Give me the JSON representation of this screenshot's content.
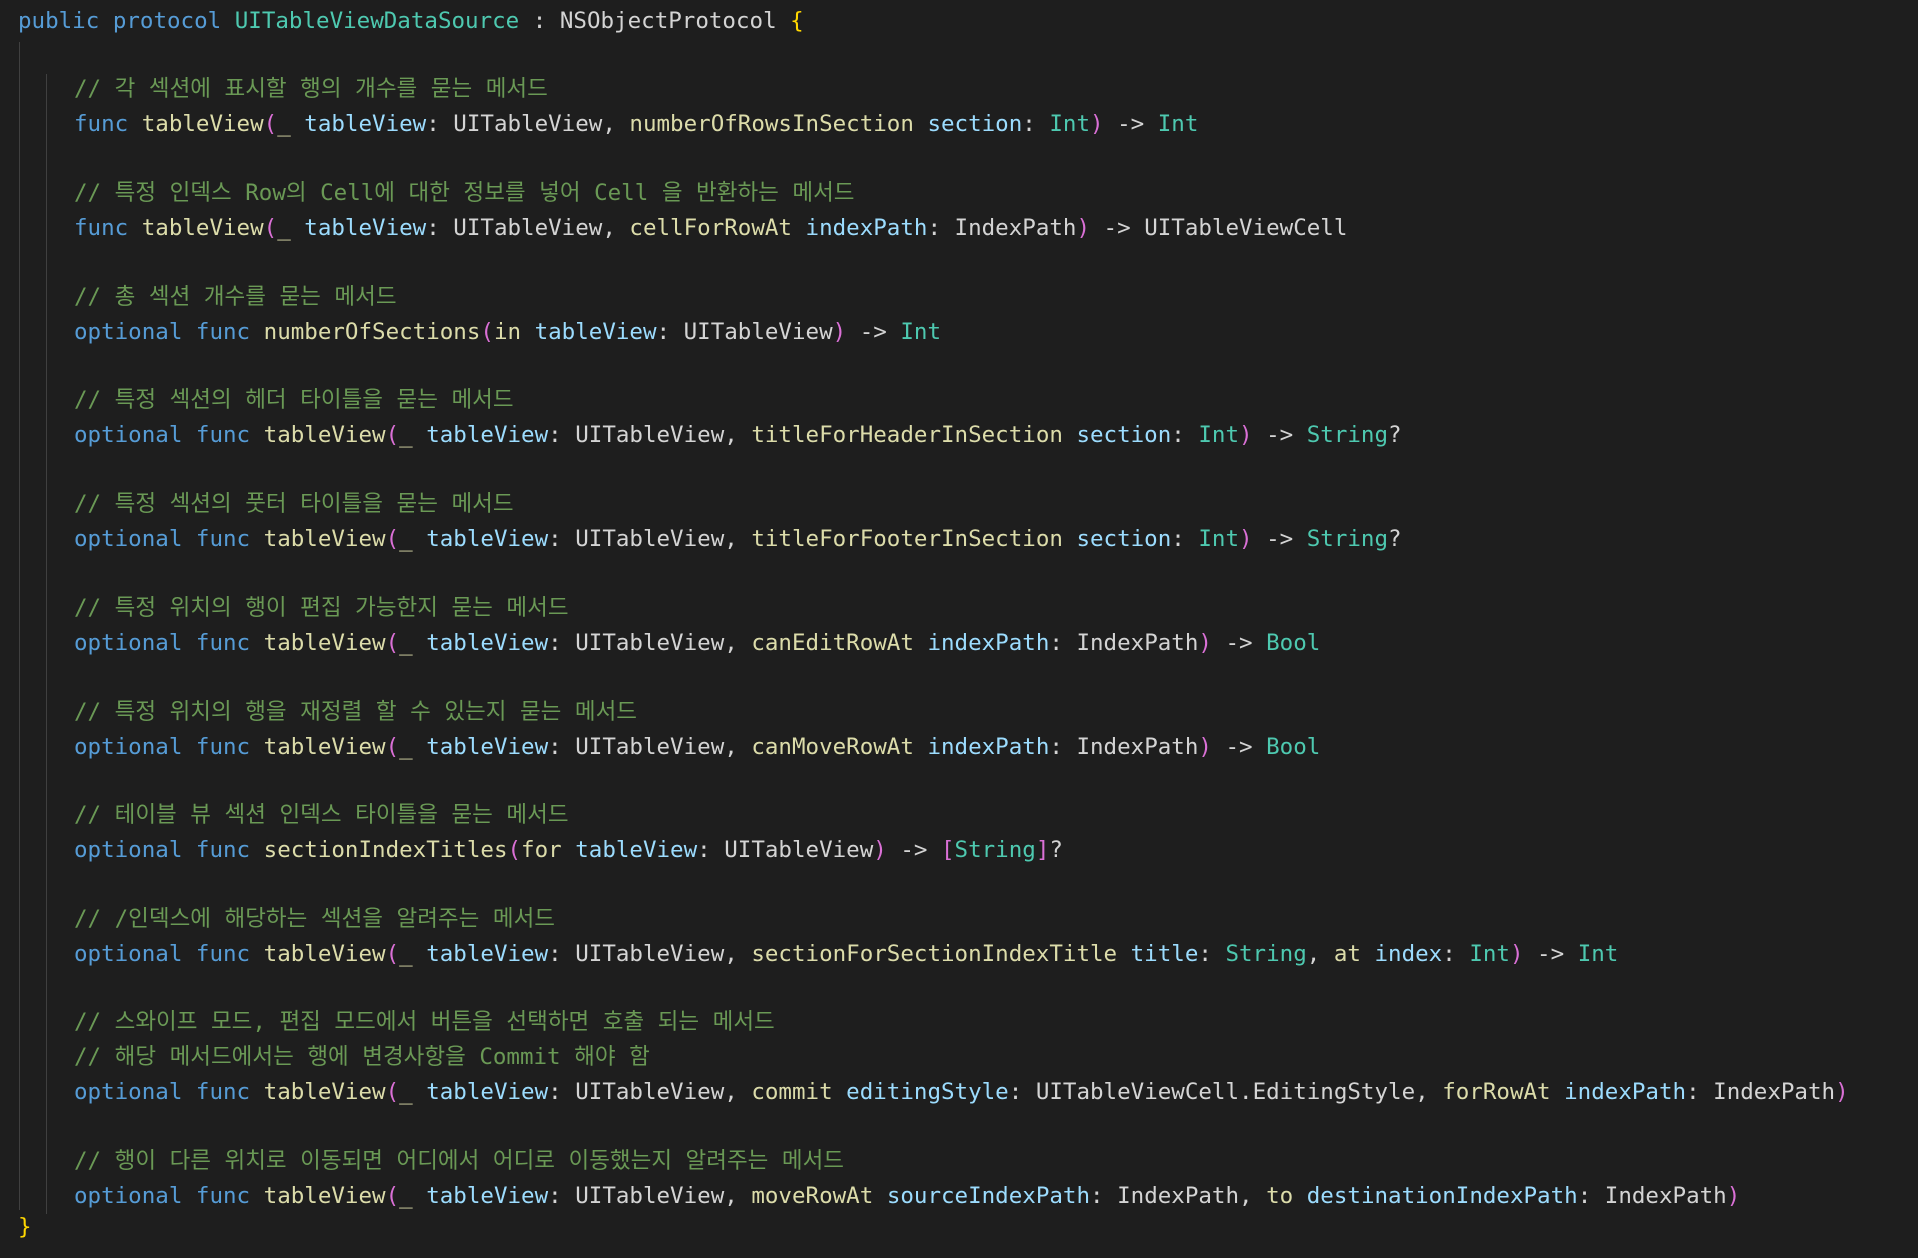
{
  "editor": {
    "background": "#1e1e1e",
    "token_colors": {
      "kw": "#569cd6",
      "fn": "#dcdcaa",
      "param": "#9cdcfe",
      "type": "#4ec9b0",
      "cmt": "#6a9955",
      "plain": "#d4d4d4",
      "b1": "#ffd700",
      "b2": "#da70d6"
    },
    "lines": [
      {
        "indent": 0,
        "tokens": [
          {
            "t": "public protocol ",
            "c": "kw"
          },
          {
            "t": "UITableViewDataSource",
            "c": "type"
          },
          {
            "t": " : NSObjectProtocol ",
            "c": "plain"
          },
          {
            "t": "{",
            "c": "b1"
          }
        ]
      },
      {
        "indent": 1,
        "tokens": [
          {
            "t": "// 각 섹션에 표시할 행의 개수를 묻는 메서드",
            "c": "cmt"
          }
        ]
      },
      {
        "indent": 1,
        "tokens": [
          {
            "t": "func ",
            "c": "kw"
          },
          {
            "t": "tableView",
            "c": "fn"
          },
          {
            "t": "(",
            "c": "b2"
          },
          {
            "t": "_ ",
            "c": "fn"
          },
          {
            "t": "tableView",
            "c": "param"
          },
          {
            "t": ": UITableView, ",
            "c": "plain"
          },
          {
            "t": "numberOfRowsInSection ",
            "c": "fn"
          },
          {
            "t": "section",
            "c": "param"
          },
          {
            "t": ": ",
            "c": "plain"
          },
          {
            "t": "Int",
            "c": "type"
          },
          {
            "t": ")",
            "c": "b2"
          },
          {
            "t": " -> ",
            "c": "plain"
          },
          {
            "t": "Int",
            "c": "type"
          }
        ]
      },
      {
        "indent": 1,
        "tokens": [
          {
            "t": "// 특정 인덱스 Row의 Cell에 대한 정보를 넣어 Cell 을 반환하는 메서드",
            "c": "cmt"
          }
        ]
      },
      {
        "indent": 1,
        "tokens": [
          {
            "t": "func ",
            "c": "kw"
          },
          {
            "t": "tableView",
            "c": "fn"
          },
          {
            "t": "(",
            "c": "b2"
          },
          {
            "t": "_ ",
            "c": "fn"
          },
          {
            "t": "tableView",
            "c": "param"
          },
          {
            "t": ": UITableView, ",
            "c": "plain"
          },
          {
            "t": "cellForRowAt ",
            "c": "fn"
          },
          {
            "t": "indexPath",
            "c": "param"
          },
          {
            "t": ": IndexPath",
            "c": "plain"
          },
          {
            "t": ")",
            "c": "b2"
          },
          {
            "t": " -> UITableViewCell",
            "c": "plain"
          }
        ]
      },
      {
        "indent": 1,
        "tokens": [
          {
            "t": "// 총 섹션 개수를 묻는 메서드",
            "c": "cmt"
          }
        ]
      },
      {
        "indent": 1,
        "tokens": [
          {
            "t": "optional func ",
            "c": "kw"
          },
          {
            "t": "numberOfSections",
            "c": "fn"
          },
          {
            "t": "(",
            "c": "b2"
          },
          {
            "t": "in ",
            "c": "fn"
          },
          {
            "t": "tableView",
            "c": "param"
          },
          {
            "t": ": UITableView",
            "c": "plain"
          },
          {
            "t": ")",
            "c": "b2"
          },
          {
            "t": " -> ",
            "c": "plain"
          },
          {
            "t": "Int",
            "c": "type"
          }
        ]
      },
      {
        "indent": 1,
        "tokens": [
          {
            "t": "// 특정 섹션의 헤더 타이틀을 묻는 메서드",
            "c": "cmt"
          }
        ]
      },
      {
        "indent": 1,
        "tokens": [
          {
            "t": "optional func ",
            "c": "kw"
          },
          {
            "t": "tableView",
            "c": "fn"
          },
          {
            "t": "(",
            "c": "b2"
          },
          {
            "t": "_ ",
            "c": "fn"
          },
          {
            "t": "tableView",
            "c": "param"
          },
          {
            "t": ": UITableView, ",
            "c": "plain"
          },
          {
            "t": "titleForHeaderInSection ",
            "c": "fn"
          },
          {
            "t": "section",
            "c": "param"
          },
          {
            "t": ": ",
            "c": "plain"
          },
          {
            "t": "Int",
            "c": "type"
          },
          {
            "t": ")",
            "c": "b2"
          },
          {
            "t": " -> ",
            "c": "plain"
          },
          {
            "t": "String",
            "c": "type"
          },
          {
            "t": "?",
            "c": "plain"
          }
        ]
      },
      {
        "indent": 1,
        "tokens": [
          {
            "t": "// 특정 섹션의 풋터 타이틀을 묻는 메서드",
            "c": "cmt"
          }
        ]
      },
      {
        "indent": 1,
        "tokens": [
          {
            "t": "optional func ",
            "c": "kw"
          },
          {
            "t": "tableView",
            "c": "fn"
          },
          {
            "t": "(",
            "c": "b2"
          },
          {
            "t": "_ ",
            "c": "fn"
          },
          {
            "t": "tableView",
            "c": "param"
          },
          {
            "t": ": UITableView, ",
            "c": "plain"
          },
          {
            "t": "titleForFooterInSection ",
            "c": "fn"
          },
          {
            "t": "section",
            "c": "param"
          },
          {
            "t": ": ",
            "c": "plain"
          },
          {
            "t": "Int",
            "c": "type"
          },
          {
            "t": ")",
            "c": "b2"
          },
          {
            "t": " -> ",
            "c": "plain"
          },
          {
            "t": "String",
            "c": "type"
          },
          {
            "t": "?",
            "c": "plain"
          }
        ]
      },
      {
        "indent": 1,
        "tokens": [
          {
            "t": "// 특정 위치의 행이 편집 가능한지 묻는 메서드",
            "c": "cmt"
          }
        ]
      },
      {
        "indent": 1,
        "tokens": [
          {
            "t": "optional func ",
            "c": "kw"
          },
          {
            "t": "tableView",
            "c": "fn"
          },
          {
            "t": "(",
            "c": "b2"
          },
          {
            "t": "_ ",
            "c": "fn"
          },
          {
            "t": "tableView",
            "c": "param"
          },
          {
            "t": ": UITableView, ",
            "c": "plain"
          },
          {
            "t": "canEditRowAt ",
            "c": "fn"
          },
          {
            "t": "indexPath",
            "c": "param"
          },
          {
            "t": ": IndexPath",
            "c": "plain"
          },
          {
            "t": ")",
            "c": "b2"
          },
          {
            "t": " -> ",
            "c": "plain"
          },
          {
            "t": "Bool",
            "c": "type"
          }
        ]
      },
      {
        "indent": 1,
        "tokens": [
          {
            "t": "// 특정 위치의 행을 재정렬 할 수 있는지 묻는 메서드",
            "c": "cmt"
          }
        ]
      },
      {
        "indent": 1,
        "tokens": [
          {
            "t": "optional func ",
            "c": "kw"
          },
          {
            "t": "tableView",
            "c": "fn"
          },
          {
            "t": "(",
            "c": "b2"
          },
          {
            "t": "_ ",
            "c": "fn"
          },
          {
            "t": "tableView",
            "c": "param"
          },
          {
            "t": ": UITableView, ",
            "c": "plain"
          },
          {
            "t": "canMoveRowAt ",
            "c": "fn"
          },
          {
            "t": "indexPath",
            "c": "param"
          },
          {
            "t": ": IndexPath",
            "c": "plain"
          },
          {
            "t": ")",
            "c": "b2"
          },
          {
            "t": " -> ",
            "c": "plain"
          },
          {
            "t": "Bool",
            "c": "type"
          }
        ]
      },
      {
        "indent": 1,
        "tokens": [
          {
            "t": "// 테이블 뷰 섹션 인덱스 타이틀을 묻는 메서드",
            "c": "cmt"
          }
        ]
      },
      {
        "indent": 1,
        "tokens": [
          {
            "t": "optional func ",
            "c": "kw"
          },
          {
            "t": "sectionIndexTitles",
            "c": "fn"
          },
          {
            "t": "(",
            "c": "b2"
          },
          {
            "t": "for ",
            "c": "fn"
          },
          {
            "t": "tableView",
            "c": "param"
          },
          {
            "t": ": UITableView",
            "c": "plain"
          },
          {
            "t": ")",
            "c": "b2"
          },
          {
            "t": " -> ",
            "c": "plain"
          },
          {
            "t": "[",
            "c": "b2"
          },
          {
            "t": "String",
            "c": "type"
          },
          {
            "t": "]",
            "c": "b2"
          },
          {
            "t": "?",
            "c": "plain"
          }
        ]
      },
      {
        "indent": 1,
        "tokens": [
          {
            "t": "// /인덱스에 해당하는 섹션을 알려주는 메서드",
            "c": "cmt"
          }
        ]
      },
      {
        "indent": 1,
        "tokens": [
          {
            "t": "optional func ",
            "c": "kw"
          },
          {
            "t": "tableView",
            "c": "fn"
          },
          {
            "t": "(",
            "c": "b2"
          },
          {
            "t": "_ ",
            "c": "fn"
          },
          {
            "t": "tableView",
            "c": "param"
          },
          {
            "t": ": UITableView, ",
            "c": "plain"
          },
          {
            "t": "sectionForSectionIndexTitle ",
            "c": "fn"
          },
          {
            "t": "title",
            "c": "param"
          },
          {
            "t": ": ",
            "c": "plain"
          },
          {
            "t": "String",
            "c": "type"
          },
          {
            "t": ", ",
            "c": "plain"
          },
          {
            "t": "at ",
            "c": "fn"
          },
          {
            "t": "index",
            "c": "param"
          },
          {
            "t": ": ",
            "c": "plain"
          },
          {
            "t": "Int",
            "c": "type"
          },
          {
            "t": ")",
            "c": "b2"
          },
          {
            "t": " -> ",
            "c": "plain"
          },
          {
            "t": "Int",
            "c": "type"
          }
        ]
      },
      {
        "indent": 1,
        "tokens": [
          {
            "t": "// 스와이프 모드, 편집 모드에서 버튼을 선택하면 호출 되는 메서드",
            "c": "cmt"
          }
        ]
      },
      {
        "indent": 1,
        "tokens": [
          {
            "t": "// 해당 메서드에서는 행에 변경사항을 Commit 해야 함",
            "c": "cmt"
          }
        ]
      },
      {
        "indent": 1,
        "tokens": [
          {
            "t": "optional func ",
            "c": "kw"
          },
          {
            "t": "tableView",
            "c": "fn"
          },
          {
            "t": "(",
            "c": "b2"
          },
          {
            "t": "_ ",
            "c": "fn"
          },
          {
            "t": "tableView",
            "c": "param"
          },
          {
            "t": ": UITableView, ",
            "c": "plain"
          },
          {
            "t": "commit ",
            "c": "fn"
          },
          {
            "t": "editingStyle",
            "c": "param"
          },
          {
            "t": ": UITableViewCell.EditingStyle, ",
            "c": "plain"
          },
          {
            "t": "forRowAt ",
            "c": "fn"
          },
          {
            "t": "indexPath",
            "c": "param"
          },
          {
            "t": ": IndexPath",
            "c": "plain"
          },
          {
            "t": ")",
            "c": "b2"
          }
        ]
      },
      {
        "indent": 1,
        "tokens": [
          {
            "t": "// 행이 다른 위치로 이동되면 어디에서 어디로 이동했는지 알려주는 메서드",
            "c": "cmt"
          }
        ]
      },
      {
        "indent": 1,
        "tokens": [
          {
            "t": "optional func ",
            "c": "kw"
          },
          {
            "t": "tableView",
            "c": "fn"
          },
          {
            "t": "(",
            "c": "b2"
          },
          {
            "t": "_ ",
            "c": "fn"
          },
          {
            "t": "tableView",
            "c": "param"
          },
          {
            "t": ": UITableView, ",
            "c": "plain"
          },
          {
            "t": "moveRowAt ",
            "c": "fn"
          },
          {
            "t": "sourceIndexPath",
            "c": "param"
          },
          {
            "t": ": IndexPath, ",
            "c": "plain"
          },
          {
            "t": "to ",
            "c": "fn"
          },
          {
            "t": "destinationIndexPath",
            "c": "param"
          },
          {
            "t": ": IndexPath",
            "c": "plain"
          },
          {
            "t": ")",
            "c": "b2"
          }
        ]
      },
      {
        "indent": 0,
        "tokens": [
          {
            "t": "}",
            "c": "b1"
          }
        ]
      }
    ]
  }
}
